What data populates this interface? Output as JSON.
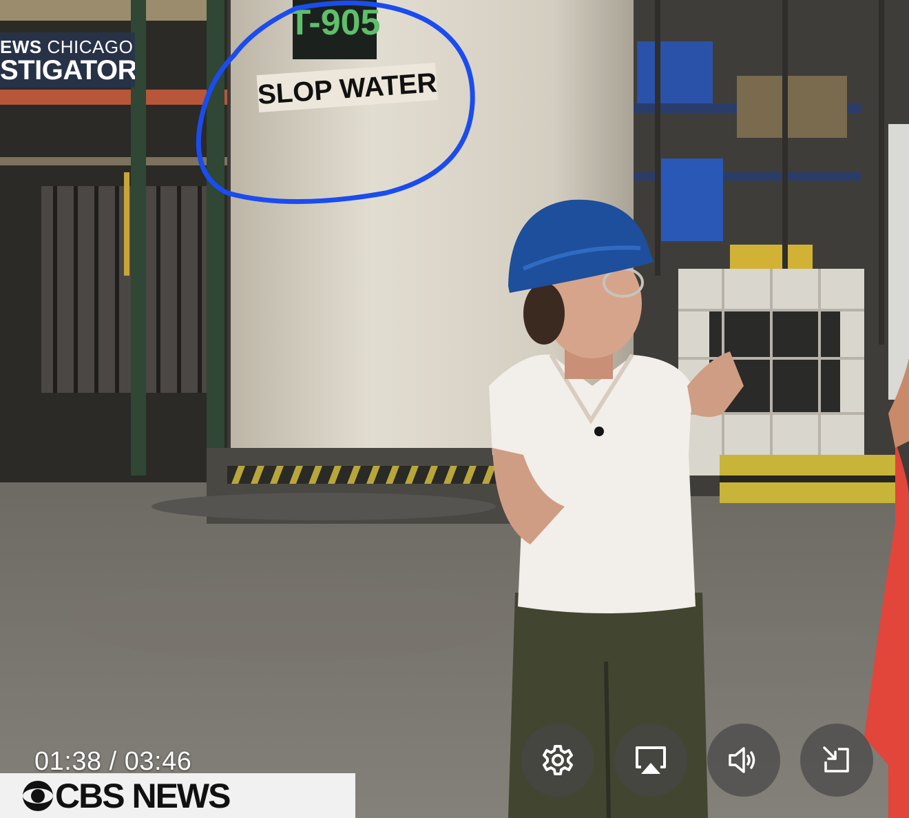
{
  "video": {
    "time_current": "01:38",
    "time_separator": "/",
    "time_total": "03:46",
    "time_display": "01:38 / 03:46"
  },
  "news_bug": {
    "line1_bold": "EWS",
    "line1_rest": " CHICAGO",
    "line2": "STIGATORS",
    "background_color": "#2c3850"
  },
  "broadcaster": {
    "logo_text": "CBS NEWS",
    "icon": "cbs-eye-icon"
  },
  "scene": {
    "tank_number": "T-905",
    "tank_label": "SLOP WATER",
    "annotation_color": "#1a4cf0"
  },
  "controls": [
    {
      "name": "settings",
      "icon": "gear-icon"
    },
    {
      "name": "airplay",
      "icon": "airplay-icon"
    },
    {
      "name": "volume",
      "icon": "speaker-icon"
    },
    {
      "name": "exit-fullscreen",
      "icon": "collapse-icon"
    }
  ]
}
